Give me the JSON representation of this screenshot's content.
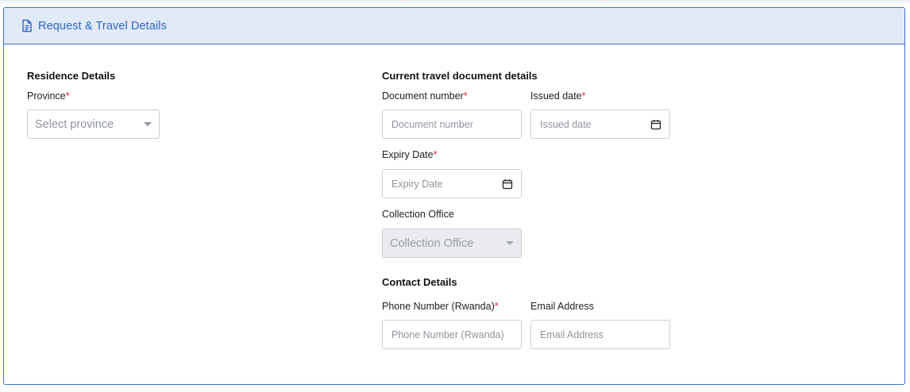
{
  "panel": {
    "title": "Request & Travel Details",
    "icon": "document-icon"
  },
  "residence": {
    "section_title": "Residence Details",
    "province": {
      "label": "Province",
      "required_mark": "*",
      "placeholder": "Select province"
    }
  },
  "travel_document": {
    "section_title": "Current travel document details",
    "document_number": {
      "label": "Document number",
      "required_mark": "*",
      "placeholder": "Document number"
    },
    "issued_date": {
      "label": "Issued date",
      "required_mark": "*",
      "placeholder": "Issued date",
      "icon": "calendar-icon"
    },
    "expiry_date": {
      "label": "Expiry Date",
      "required_mark": "*",
      "placeholder": "Expiry Date",
      "icon": "calendar-icon"
    },
    "collection_office": {
      "label": "Collection Office",
      "placeholder": "Collection Office",
      "disabled": true
    }
  },
  "contact": {
    "section_title": "Contact Details",
    "phone": {
      "label": "Phone Number (Rwanda)",
      "required_mark": "*",
      "placeholder": "Phone Number (Rwanda)"
    },
    "email": {
      "label": "Email Address",
      "placeholder": "Email Address"
    }
  },
  "colors": {
    "accent": "#2f63c6",
    "header_bg": "#e1ebf8",
    "required": "#e0243a",
    "disabled_bg": "#e9ebee"
  }
}
